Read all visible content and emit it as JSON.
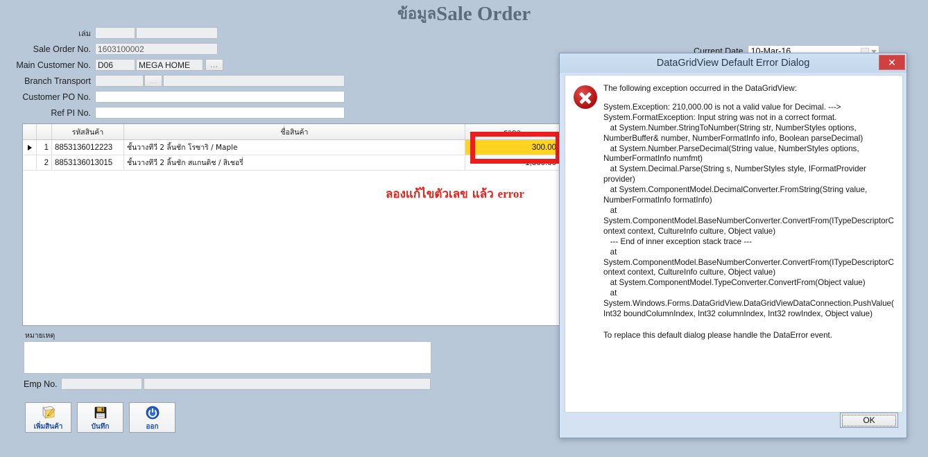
{
  "window": {
    "title_thai": "ข้อมูล",
    "title_en": "Sale Order"
  },
  "form": {
    "fields": [
      {
        "label": "เล่ม",
        "value": "",
        "value2": ""
      },
      {
        "label": "Sale Order No.",
        "value": "1603100002"
      },
      {
        "label": "Main Customer No.",
        "value": "D06",
        "value2": "MEGA HOME",
        "button": "..."
      },
      {
        "label": "Branch Transport",
        "value": "",
        "button": "...",
        "value2": ""
      },
      {
        "label": "Customer PO No.",
        "value": ""
      },
      {
        "label": "Ref PI No.",
        "value": ""
      }
    ],
    "current_date": {
      "label": "Current Date",
      "value": "10-Mar-16"
    }
  },
  "grid": {
    "columns": [
      "",
      "",
      "รหัสสินค้า",
      "ชื่อสินค้า",
      "ราคา"
    ],
    "rows": [
      {
        "selector": "▶",
        "no": "1",
        "code": "8853136012223",
        "name": "ชั้นวางทีวี 2 ลิ้นชัก โรซาริ / Maple",
        "amount": "300.00",
        "highlight": true
      },
      {
        "selector": "",
        "no": "2",
        "code": "8853136013015",
        "name": "ชั้นวางทีวี 2 ลิ้นชัก สแกนดิช / สิเชอรี่",
        "amount": "1,500.00",
        "highlight": false
      }
    ]
  },
  "annotation": {
    "thai": "ลองแก้ไขตัวเลข แล้ว ",
    "en": "error"
  },
  "footer": {
    "remark_label": "หมายเหตุ",
    "remark_value": "",
    "emp_label": "Emp No.",
    "emp_code": "",
    "emp_name": "",
    "buttons": [
      {
        "label": "เพิ่มสินค้า",
        "icon": "add-product-icon"
      },
      {
        "label": "บันทึก",
        "icon": "save-floppy-icon"
      },
      {
        "label": "ออก",
        "icon": "power-exit-icon"
      }
    ]
  },
  "dialog": {
    "title": "DataGridView Default Error Dialog",
    "close_label": "✕",
    "icon": "error-circle-icon",
    "heading": "The following exception occurred in the DataGridView:",
    "body": "System.Exception: 210,000.00 is not a valid value for Decimal. --->\nSystem.FormatException: Input string was not in a correct format.\n   at System.Number.StringToNumber(String str, NumberStyles options, NumberBuffer& number, NumberFormatInfo info, Boolean parseDecimal)\n   at System.Number.ParseDecimal(String value, NumberStyles options, NumberFormatInfo numfmt)\n   at System.Decimal.Parse(String s, NumberStyles style, IFormatProvider provider)\n   at System.ComponentModel.DecimalConverter.FromString(String value, NumberFormatInfo formatInfo)\n   at System.ComponentModel.BaseNumberConverter.ConvertFrom(ITypeDescriptorContext context, CultureInfo culture, Object value)\n   --- End of inner exception stack trace ---\n   at System.ComponentModel.BaseNumberConverter.ConvertFrom(ITypeDescriptorContext context, CultureInfo culture, Object value)\n   at System.ComponentModel.TypeConverter.ConvertFrom(Object value)\n   at System.Windows.Forms.DataGridView.DataGridViewDataConnection.PushValue(Int32 boundColumnIndex, Int32 columnIndex, Int32 rowIndex, Object value)",
    "footer": "To replace this default dialog please handle the DataError event.",
    "ok_label": "OK"
  },
  "colors": {
    "background": "#b9c8d8",
    "highlight_cell": "#ffd321",
    "annotation_red": "#e8231c",
    "dialog_title_text": "#27384d"
  }
}
